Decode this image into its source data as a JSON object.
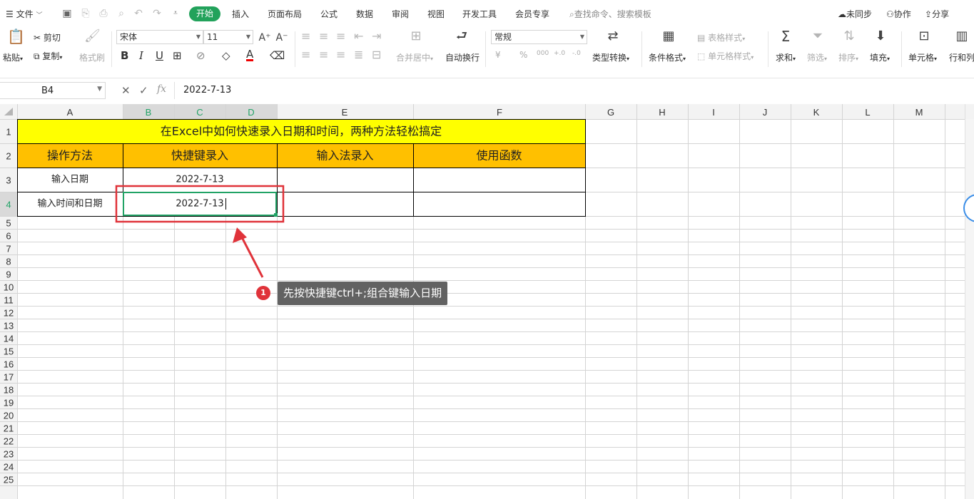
{
  "menubar": {
    "file": "文件",
    "tabs": [
      "开始",
      "插入",
      "页面布局",
      "公式",
      "数据",
      "审阅",
      "视图",
      "开发工具",
      "会员专享"
    ],
    "search_placeholder": "查找命令、搜索模板",
    "sync": "未同步",
    "collab": "协作",
    "share": "分享"
  },
  "ribbon": {
    "paste": "粘贴",
    "cut": "剪切",
    "copy": "复制",
    "format_painter": "格式刷",
    "font_name": "宋体",
    "font_size": "11",
    "merge_center": "合并居中",
    "wrap_text": "自动换行",
    "number_format": "常规",
    "type_convert": "类型转换",
    "conditional_format": "条件格式",
    "table_style": "表格样式",
    "cell_style": "单元格样式",
    "sum": "求和",
    "filter": "筛选",
    "sort": "排序",
    "fill": "填充",
    "cell": "单元格",
    "row_col": "行和列",
    "num_buttons": [
      "¥",
      "%",
      "000",
      "+.0",
      "-.0"
    ]
  },
  "formula_bar": {
    "name_box": "B4",
    "fx": "fx",
    "value": "2022-7-13"
  },
  "sheet": {
    "columns": [
      "A",
      "B",
      "C",
      "D",
      "E",
      "F",
      "G",
      "H",
      "I",
      "J",
      "K",
      "L",
      "M"
    ],
    "rows": [
      "1",
      "2",
      "3",
      "4",
      "5",
      "6",
      "7",
      "8",
      "9",
      "10",
      "11",
      "12",
      "13",
      "14",
      "15",
      "16",
      "17",
      "18",
      "19",
      "20",
      "21",
      "22",
      "23",
      "24",
      "25"
    ],
    "title": "在Excel中如何快速录入日期和时间，两种方法轻松搞定",
    "headers": [
      "操作方法",
      "快捷键录入",
      "输入法录入",
      "使用函数"
    ],
    "row3": [
      "输入日期",
      "2022-7-13",
      "",
      ""
    ],
    "row4": [
      "输入时间和日期",
      "2022-7-13",
      "",
      ""
    ],
    "colors": {
      "title_fill": "#ffff00",
      "header_fill": "#ffc000",
      "grid": "#d4d4d4",
      "selection": "#21a366",
      "annotation_red": "#e0333a"
    }
  },
  "annotation": {
    "badge": "1",
    "text": "先按快捷键ctrl+;组合键输入日期"
  }
}
